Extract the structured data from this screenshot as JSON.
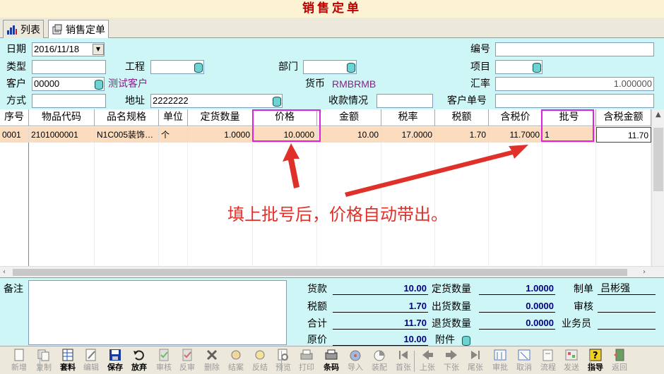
{
  "window_title": "销售定单",
  "tabs": [
    {
      "label": "列表"
    },
    {
      "label": "销售定单"
    }
  ],
  "form": {
    "date_label": "日期",
    "date_value": "2016/11/18",
    "type_label": "类型",
    "type_value": "",
    "project_label": "工程",
    "project_value": "",
    "dept_label": "部门",
    "dept_value": "",
    "item_label": "项目",
    "item_value": "",
    "number_label": "编号",
    "number_value": "",
    "customer_label": "客户",
    "customer_code": "00000",
    "customer_name": "测试客户",
    "currency_label": "货币",
    "currency_value": "RMBRMB",
    "rate_label": "汇率",
    "rate_value": "1.000000",
    "method_label": "方式",
    "method_value": "",
    "address_label": "地址",
    "address_value": "2222222",
    "collection_label": "收款情况",
    "collection_value": "",
    "customer_order_label": "客户单号",
    "customer_order_value": ""
  },
  "grid": {
    "headers": [
      "序号",
      "物品代码",
      "品名规格",
      "单位",
      "定货数量",
      "价格",
      "金额",
      "税率",
      "税额",
      "含税价",
      "批号",
      "含税金额"
    ],
    "rows": [
      [
        "0001",
        "2101000001",
        "N1C005装饰…",
        "个",
        "1.0000",
        "10.0000",
        "10.00",
        "17.0000",
        "1.70",
        "11.7000",
        "1",
        "11.70"
      ]
    ]
  },
  "annotation": "填上批号后，价格自动带出。",
  "footer": {
    "remark_label": "备注",
    "remark_value": "",
    "goods_label": "货款",
    "goods_value": "10.00",
    "tax_label": "税额",
    "tax_value": "1.70",
    "total_label": "合计",
    "total_value": "11.70",
    "orig_price_label": "原价",
    "orig_price_value": "10.00",
    "order_qty_label": "定货数量",
    "order_qty_value": "1.0000",
    "out_qty_label": "出货数量",
    "out_qty_value": "0.0000",
    "return_qty_label": "退货数量",
    "return_qty_value": "0.0000",
    "attach_label": "附件",
    "maker_label": "制单",
    "maker_value": "吕彬强",
    "audit_label": "审核",
    "audit_value": "",
    "salesman_label": "业务员",
    "salesman_value": ""
  },
  "toolbar": [
    {
      "label": "新增",
      "icon": "new-doc-icon",
      "enabled": false
    },
    {
      "label": "复制",
      "icon": "copy-icon",
      "enabled": false
    },
    {
      "label": "套料",
      "icon": "table-icon",
      "enabled": true
    },
    {
      "label": "编辑",
      "icon": "edit-icon",
      "enabled": false
    },
    {
      "label": "保存",
      "icon": "save-icon",
      "enabled": true
    },
    {
      "label": "放弃",
      "icon": "undo-icon",
      "enabled": true
    },
    {
      "label": "审核",
      "icon": "audit-icon",
      "enabled": false
    },
    {
      "label": "反审",
      "icon": "unaudit-icon",
      "enabled": false
    },
    {
      "label": "删除",
      "icon": "delete-icon",
      "enabled": false
    },
    {
      "label": "结案",
      "icon": "close-case-icon",
      "enabled": false
    },
    {
      "label": "反结",
      "icon": "reopen-icon",
      "enabled": false
    },
    {
      "label": "预览",
      "icon": "preview-icon",
      "enabled": false
    },
    {
      "label": "打印",
      "icon": "print-icon",
      "enabled": false
    },
    {
      "label": "条码",
      "icon": "barcode-icon",
      "enabled": true
    },
    {
      "label": "导入",
      "icon": "import-icon",
      "enabled": false
    },
    {
      "label": "装配",
      "icon": "assemble-icon",
      "enabled": false
    },
    {
      "label": "首张",
      "icon": "first-icon",
      "enabled": false
    },
    {
      "label": "上张",
      "icon": "prev-icon",
      "enabled": false
    },
    {
      "label": "下张",
      "icon": "next-icon",
      "enabled": false
    },
    {
      "label": "尾张",
      "icon": "last-icon",
      "enabled": false
    },
    {
      "label": "审批",
      "icon": "approve-icon",
      "enabled": false
    },
    {
      "label": "取消",
      "icon": "cancel-icon",
      "enabled": false
    },
    {
      "label": "流程",
      "icon": "flow-icon",
      "enabled": false
    },
    {
      "label": "发送",
      "icon": "send-icon",
      "enabled": false
    },
    {
      "label": "指导",
      "icon": "help-icon",
      "enabled": true
    },
    {
      "label": "返回",
      "icon": "exit-icon",
      "enabled": false
    }
  ],
  "colors": {
    "title": "#c00000",
    "form_bg": "#cef6f6",
    "selected_row": "#fbdcbe",
    "highlight_box": "#e020e0",
    "annotation": "#e0302a",
    "customer_name": "#8a1f8a"
  }
}
